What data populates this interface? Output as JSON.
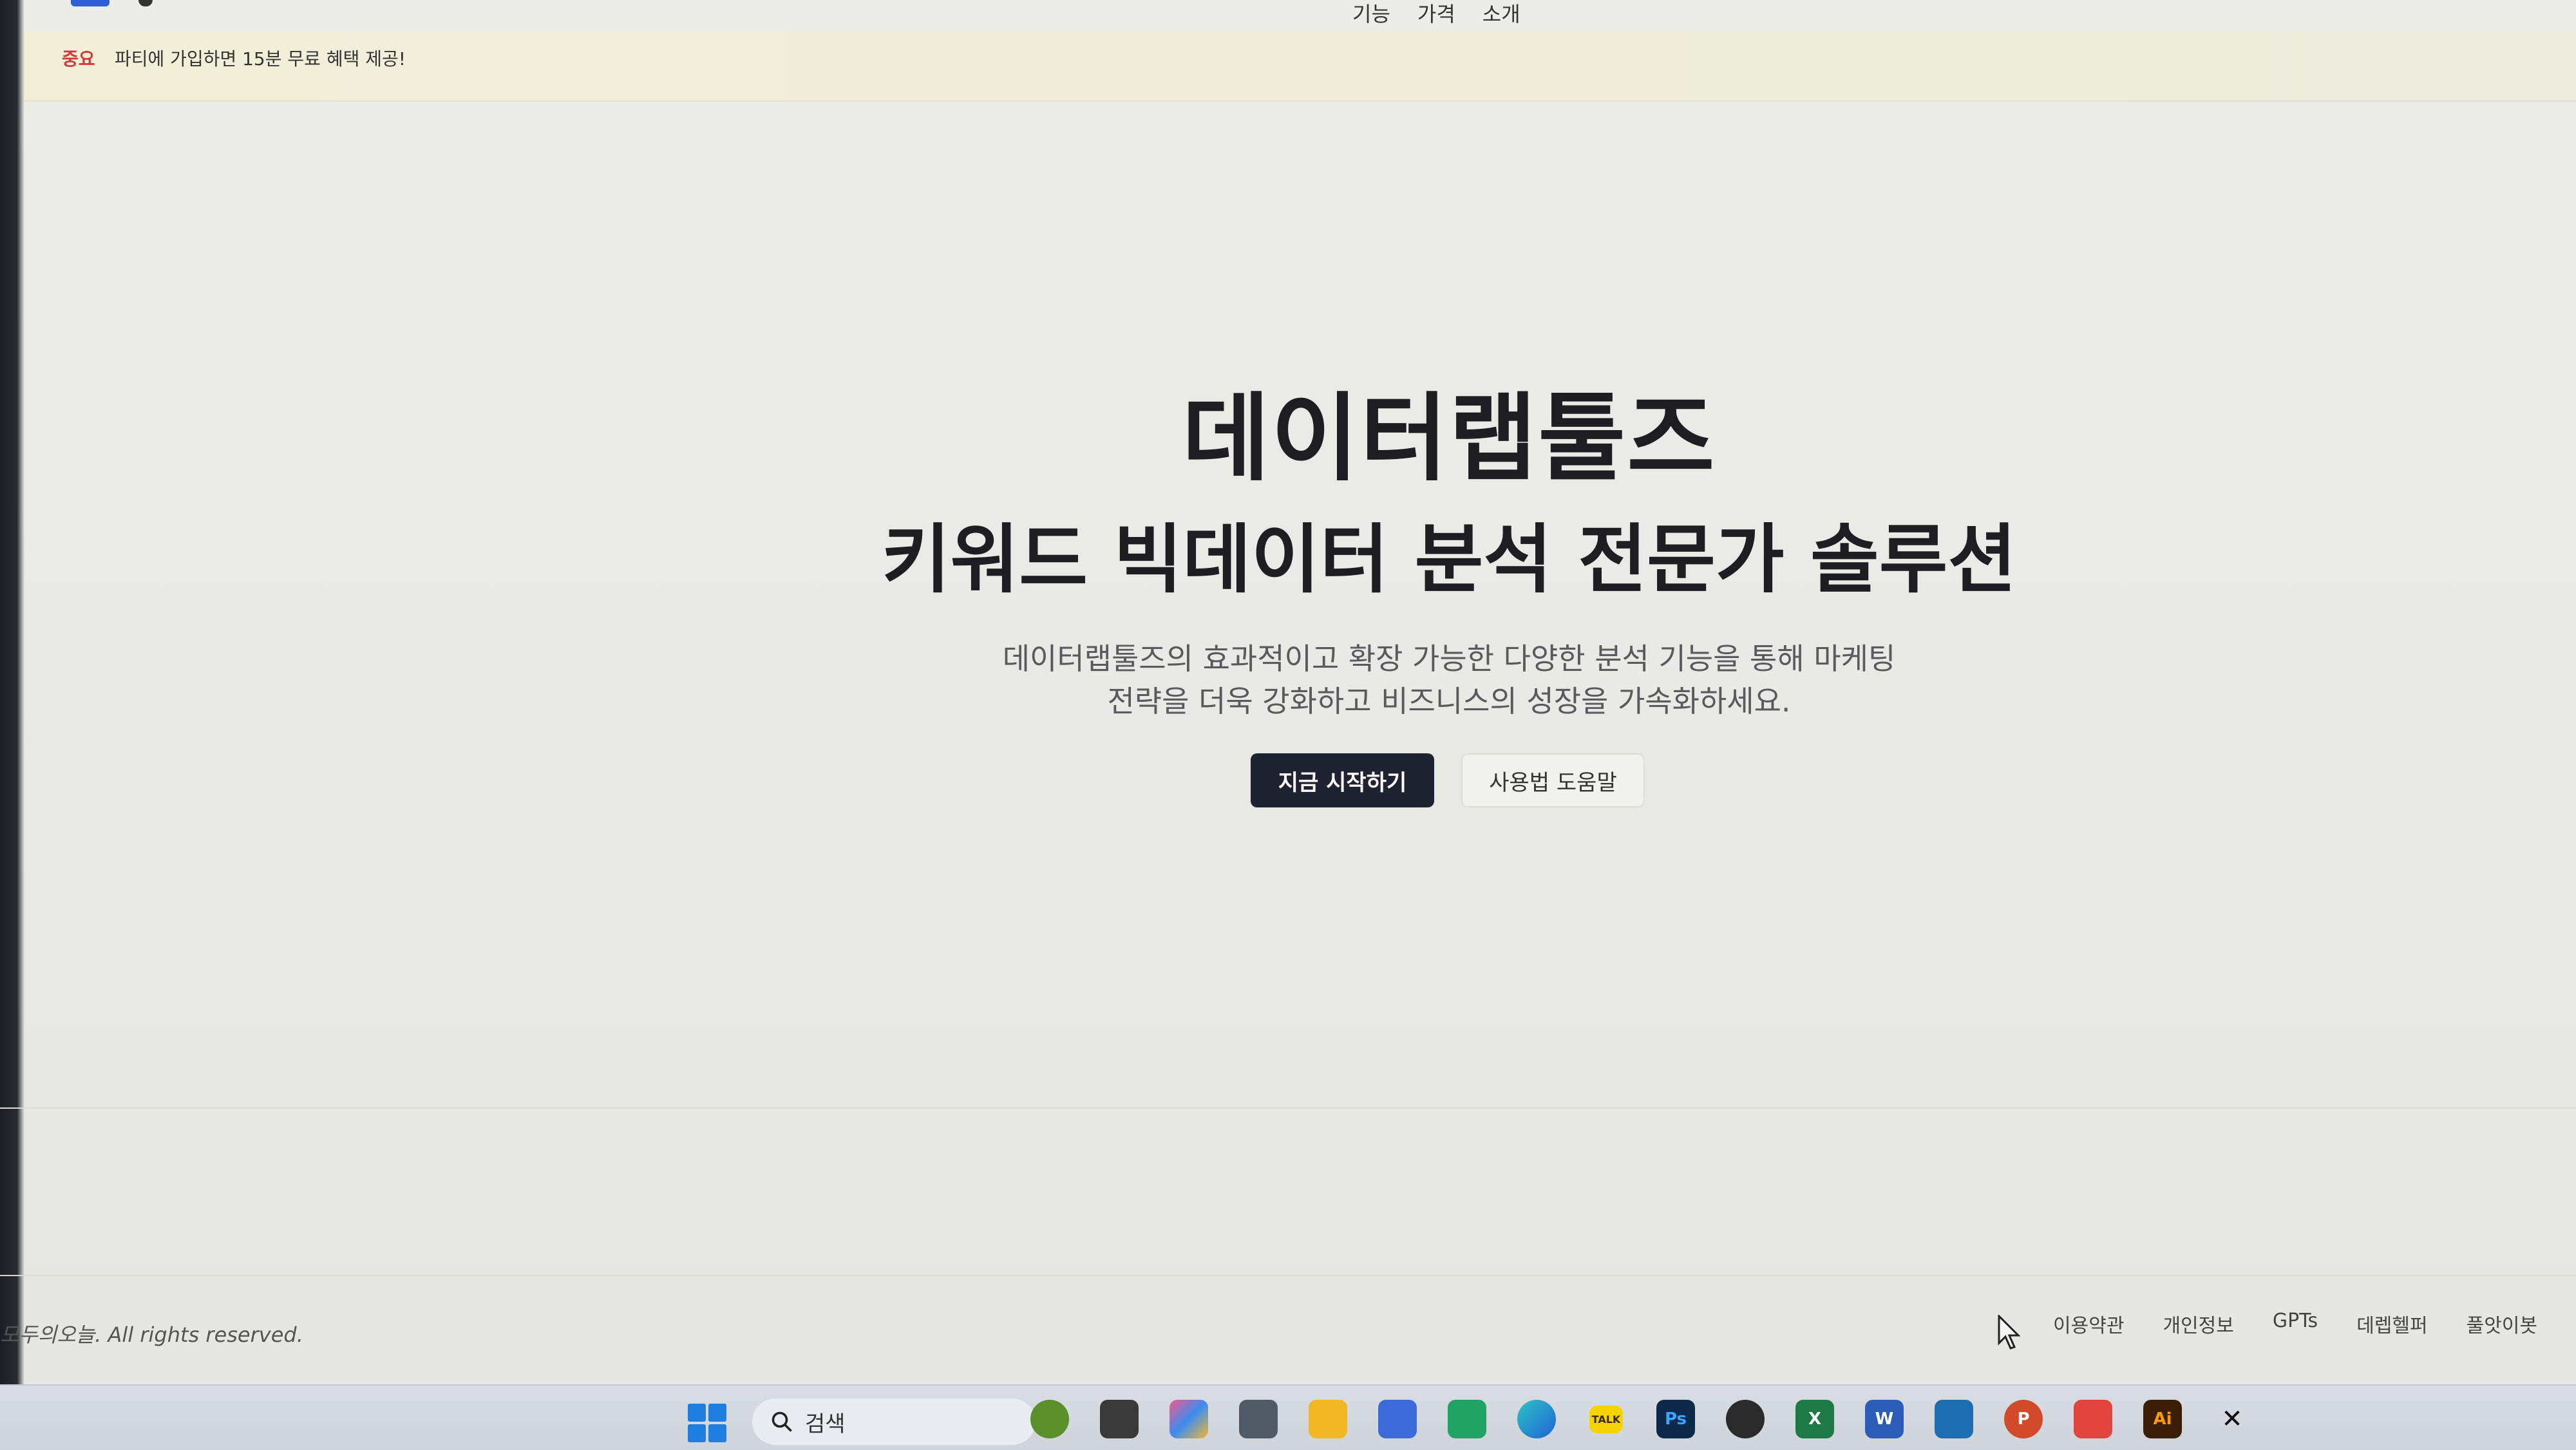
{
  "nav": {
    "links": [
      "기능",
      "가격",
      "소개"
    ]
  },
  "banner": {
    "badge": "중요",
    "text": "파티에 가입하면 15분 무료 혜택 제공!"
  },
  "hero": {
    "title": "데이터랩툴즈",
    "subtitle": "키워드 빅데이터 분석 전문가 솔루션",
    "description_line1": "데이터랩툴즈의 효과적이고 확장 가능한 다양한 분석 기능을 통해 마케팅",
    "description_line2": "전략을 더욱 강화하고 비즈니스의 성장을 가속화하세요.",
    "primary_button": "지금 시작하기",
    "secondary_button": "사용법 도움말"
  },
  "footer": {
    "copyright": "모두의오늘. All rights reserved.",
    "links": [
      "이용약관",
      "개인정보",
      "GPTs",
      "데렙헬퍼",
      "풀앗이봇"
    ]
  },
  "taskbar": {
    "search_placeholder": "검색",
    "apps": [
      {
        "name": "photoshop",
        "label": "Ps",
        "color": "#0e2a4a"
      },
      {
        "name": "excel",
        "label": "X",
        "color": "#1d7a45"
      },
      {
        "name": "word",
        "label": "W",
        "color": "#2b5db8"
      },
      {
        "name": "powerpoint",
        "label": "P",
        "color": "#d24a2a"
      },
      {
        "name": "illustrator",
        "label": "Ai",
        "color": "#3a1e05"
      },
      {
        "name": "kakaotalk",
        "label": "TALK",
        "color": "#f7d400"
      }
    ]
  }
}
